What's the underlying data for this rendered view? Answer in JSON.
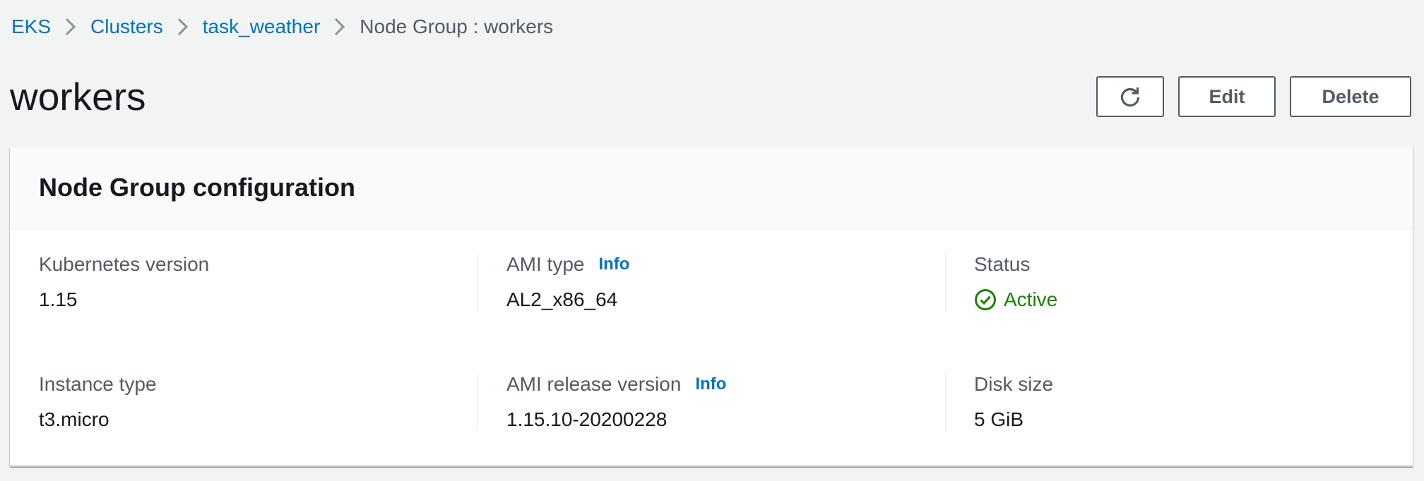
{
  "breadcrumb": {
    "items": [
      {
        "label": "EKS"
      },
      {
        "label": "Clusters"
      },
      {
        "label": "task_weather"
      }
    ],
    "current": "Node Group : workers"
  },
  "page": {
    "title": "workers"
  },
  "actions": {
    "refresh_icon": "refresh-icon",
    "edit_label": "Edit",
    "delete_label": "Delete"
  },
  "card": {
    "title": "Node Group configuration",
    "fields": {
      "kubernetes_version": {
        "label": "Kubernetes version",
        "value": "1.15"
      },
      "ami_type": {
        "label": "AMI type",
        "info": "Info",
        "value": "AL2_x86_64"
      },
      "status": {
        "label": "Status",
        "value": "Active",
        "icon": "check-circle-icon"
      },
      "instance_type": {
        "label": "Instance type",
        "value": "t3.micro"
      },
      "ami_release_version": {
        "label": "AMI release version",
        "info": "Info",
        "value": "1.15.10-20200228"
      },
      "disk_size": {
        "label": "Disk size",
        "value": "5 GiB"
      }
    }
  },
  "colors": {
    "link": "#0073bb",
    "success": "#1d8102",
    "text_secondary": "#545b64",
    "text_primary": "#16191f",
    "page_background": "#f2f3f3"
  }
}
